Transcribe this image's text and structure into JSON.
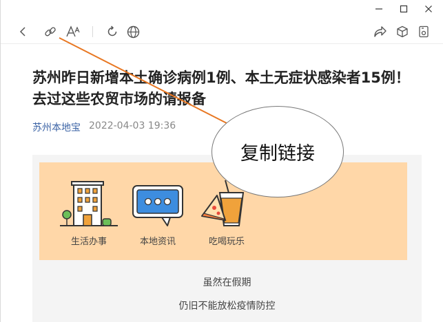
{
  "window": {
    "controls": [
      "minimize-icon",
      "maximize-icon",
      "close-icon"
    ]
  },
  "toolbar": {
    "icons": [
      "back-icon",
      "copy-link-icon",
      "font-size-icon",
      "refresh-icon",
      "globe-icon",
      "share-icon",
      "cube-icon",
      "pip-icon"
    ],
    "font_icon_glyph": "A"
  },
  "article": {
    "title": "苏州昨日新增本土确诊病例1例、本土无症状感染者15例！去过这些农贸市场的请报备",
    "source": "苏州本地宝",
    "datetime": "2022-04-03 19:36"
  },
  "banner": {
    "services": [
      {
        "label": "生活办事",
        "icon": "building-icon"
      },
      {
        "label": "本地资讯",
        "icon": "chat-bubble-icon"
      },
      {
        "label": "吃喝玩乐",
        "icon": "drink-pizza-icon"
      }
    ]
  },
  "body": {
    "lines": [
      "虽然在假期",
      "仍旧不能放松疫情防控"
    ]
  },
  "annotation": {
    "text": "复制链接",
    "line_color": "#e87722"
  },
  "colors": {
    "banner_bg": "#ffd7a8",
    "content_bg": "#f4f4f4",
    "source_link": "#3b63a5",
    "icon_orange": "#f0a23b",
    "icon_blue": "#3d8ddf"
  }
}
